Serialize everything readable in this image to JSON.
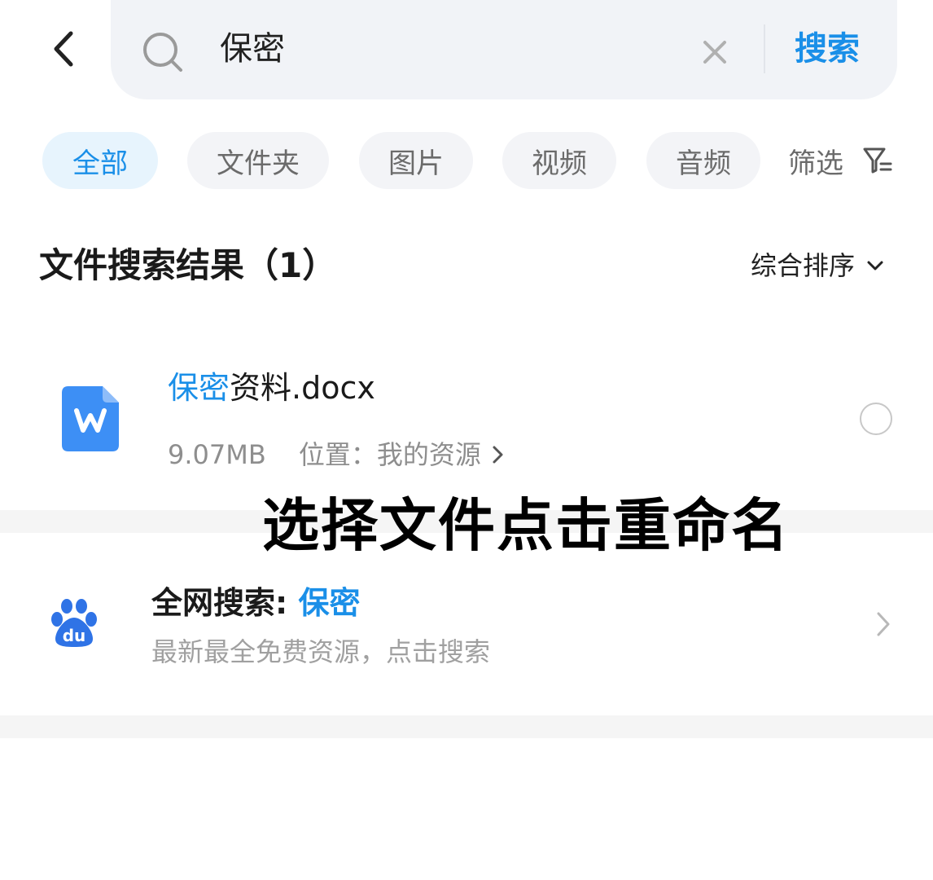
{
  "search": {
    "query": "保密",
    "submit_label": "搜索"
  },
  "tabs": [
    {
      "label": "全部",
      "active": true
    },
    {
      "label": "文件夹",
      "active": false
    },
    {
      "label": "图片",
      "active": false
    },
    {
      "label": "视频",
      "active": false
    },
    {
      "label": "音频",
      "active": false
    }
  ],
  "filter_label": "筛选",
  "results": {
    "title": "文件搜索结果（1）",
    "sort_label": "综合排序"
  },
  "file": {
    "name_highlight": "保密",
    "name_rest": "资料.docx",
    "size": "9.07MB",
    "location": "位置：我的资源"
  },
  "overlay_caption": "选择文件点击重命名",
  "web_search": {
    "title_prefix": "全网搜索:",
    "keyword": "保密",
    "subtitle": "最新最全免费资源，点击搜索"
  },
  "colors": {
    "accent": "#1a8fe8",
    "doc_icon": "#3d8ff5",
    "baidu": "#2f73e6"
  }
}
